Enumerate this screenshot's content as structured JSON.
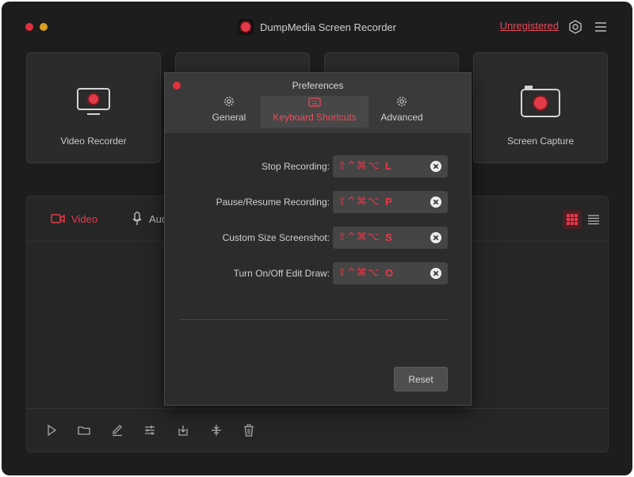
{
  "app": {
    "title": "DumpMedia Screen Recorder",
    "registration_link": "Unregistered"
  },
  "header_icons": [
    "settings-icon",
    "menu-icon"
  ],
  "colors": {
    "accent": "#e6394a",
    "background": "#1d1d1d",
    "panel": "#2c2c2c"
  },
  "cards": [
    {
      "label": "Video Recorder",
      "icon": "monitor-record-icon"
    },
    {
      "label": "",
      "icon": ""
    },
    {
      "label": "",
      "icon": ""
    },
    {
      "label": "Screen Capture",
      "icon": "camera-icon"
    }
  ],
  "media_tabs": [
    {
      "label": "Video",
      "icon": "video-camera-icon",
      "active": true
    },
    {
      "label": "Aud",
      "icon": "microphone-icon",
      "active": false
    }
  ],
  "bottom_toolbar": [
    "play-icon",
    "folder-icon",
    "edit-icon",
    "adjust-icon",
    "export-icon",
    "trim-icon",
    "trash-icon"
  ],
  "preferences": {
    "title": "Preferences",
    "tabs": [
      {
        "label": "General",
        "icon": "gear-icon",
        "active": false
      },
      {
        "label": "Keyboard Shortcuts",
        "icon": "keyboard-icon",
        "active": true
      },
      {
        "label": "Advanced",
        "icon": "gear-icon",
        "active": false
      }
    ],
    "shortcuts": [
      {
        "label": "Stop Recording:",
        "modifiers": "⇧^⌘⌥",
        "key": "L"
      },
      {
        "label": "Pause/Resume Recording:",
        "modifiers": "⇧^⌘⌥",
        "key": "P"
      },
      {
        "label": "Custom Size Screenshot:",
        "modifiers": "⇧^⌘⌥",
        "key": "S"
      },
      {
        "label": "Turn On/Off Edit Draw:",
        "modifiers": "⇧^⌘⌥",
        "key": "O"
      }
    ],
    "reset_label": "Reset"
  }
}
